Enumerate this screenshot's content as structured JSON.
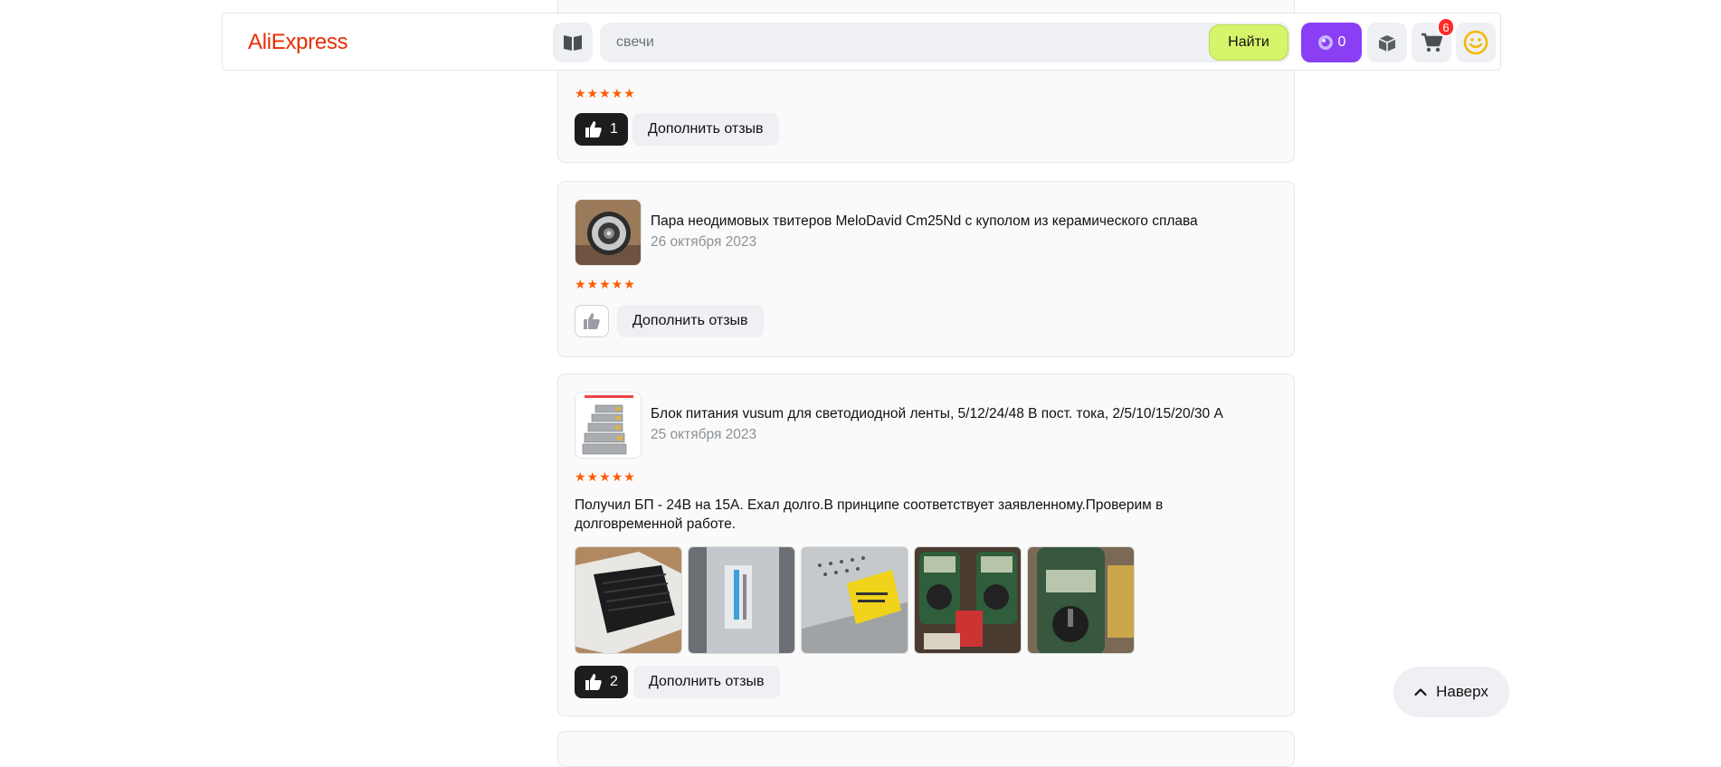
{
  "header": {
    "logo": "AliExpress",
    "search": {
      "value": "",
      "placeholder": "свечи",
      "button_label": "Найти"
    },
    "coins_count": "0",
    "cart_badge": "6",
    "accent_color": "#e62e04",
    "icons": [
      "catalog-icon",
      "coin-icon",
      "orders-icon",
      "cart-icon",
      "profile-smile-icon"
    ]
  },
  "reviews": [
    {
      "stars": "★★★★★",
      "likes": "1",
      "add_label": "Дополнить отзыв"
    },
    {
      "product_title": "Пара неодимовых твитеров MeloDavid Cm25Nd с куполом из керамического сплава",
      "date": "26 октября 2023",
      "stars": "★★★★★",
      "likes": "",
      "add_label": "Дополнить отзыв"
    },
    {
      "product_title": "Блок питания vusum для светодиодной ленты, 5/12/24/48 В пост. тока, 2/5/10/15/20/30 А",
      "date": "25 октября 2023",
      "stars": "★★★★★",
      "text": "Получил БП - 24В на 15А. Ехал долго.В принципе соответствует заявленному.Проверим  в долговременной работе.",
      "likes": "2",
      "add_label": "Дополнить отзыв"
    }
  ],
  "scroll_top_label": "Наверх",
  "star_color": "#ff5a00"
}
